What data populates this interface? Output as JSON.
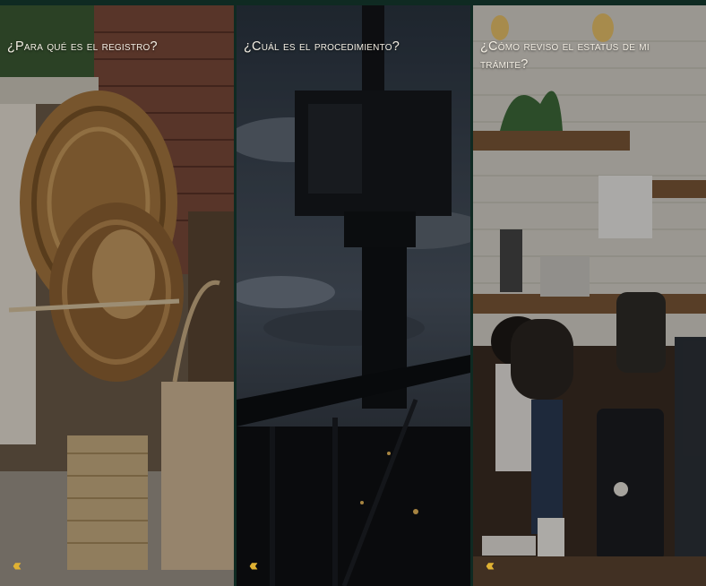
{
  "panels": [
    {
      "title": "¿Para qué es el registro?",
      "arrows": "‹‹‹",
      "scene": "wicker-baskets"
    },
    {
      "title": "¿Cuál es el procedimiento?",
      "arrows": "‹‹‹",
      "scene": "crane-silhouette-cloudy-sky"
    },
    {
      "title": "¿Cómo reviso el estatus de mi trámite?",
      "arrows": "‹‹‹",
      "scene": "coffee-shop-barista"
    }
  ],
  "colors": {
    "frame": "#0f2a22",
    "accent": "#e0b233",
    "title_text": "#f4efe4"
  }
}
